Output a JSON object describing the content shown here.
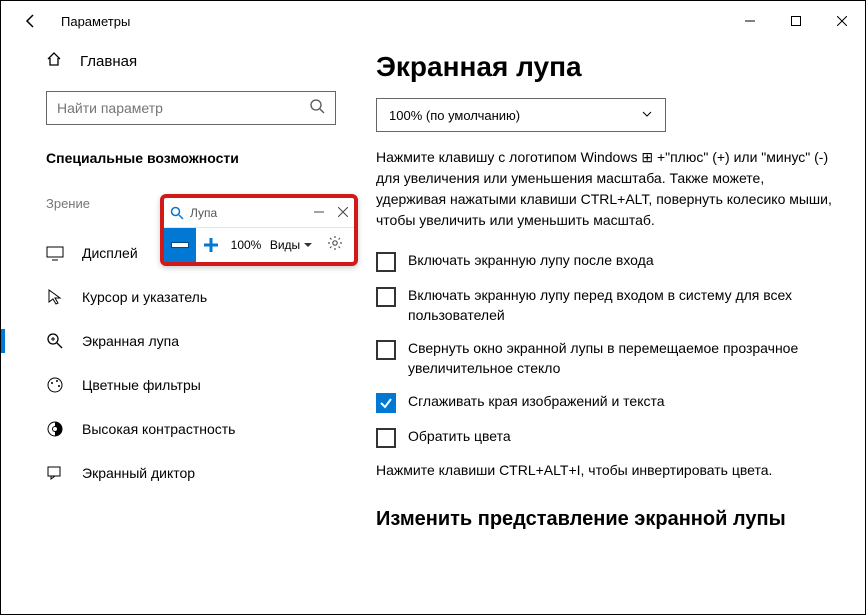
{
  "titlebar": {
    "title": "Параметры"
  },
  "sidebar": {
    "home_label": "Главная",
    "search_placeholder": "Найти параметр",
    "category": "Специальные возможности",
    "group_label": "Зрение",
    "items": [
      {
        "label": "Дисплей"
      },
      {
        "label": "Курсор и указатель"
      },
      {
        "label": "Экранная лупа"
      },
      {
        "label": "Цветные фильтры"
      },
      {
        "label": "Высокая контрастность"
      },
      {
        "label": "Экранный диктор"
      }
    ]
  },
  "content": {
    "heading": "Экранная лупа",
    "combo_value": "100% (по умолчанию)",
    "hint1": "Нажмите клавишу с логотипом Windows ⊞ +\"плюс\" (+) или \"минус\" (-) для увеличения или уменьшения масштаба. Также можете, удерживая нажатыми клавиши CTRL+ALT, повернуть колесико мыши, чтобы увеличить или уменьшить масштаб.",
    "cb1": "Включать экранную лупу после входа",
    "cb2": "Включать экранную лупу перед входом в систему для всех пользователей",
    "cb3": "Свернуть окно экранной лупы в перемещаемое прозрачное увеличительное стекло",
    "cb4": "Сглаживать края изображений и текста",
    "cb5": "Обратить цвета",
    "hint2": "Нажмите клавиши CTRL+ALT+I, чтобы инвертировать цвета.",
    "heading2": "Изменить представление экранной лупы"
  },
  "popup": {
    "title": "Лупа",
    "zoom": "100%",
    "views": "Виды"
  }
}
